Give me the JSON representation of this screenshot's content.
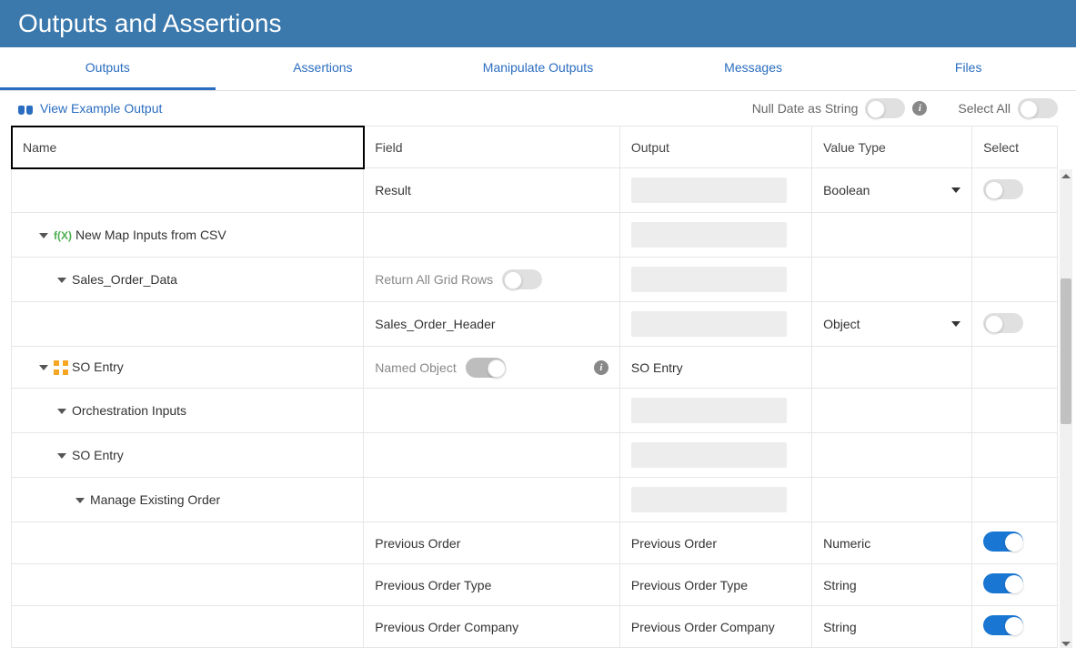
{
  "header": {
    "title": "Outputs and Assertions"
  },
  "tabs": [
    {
      "label": "Outputs",
      "active": true
    },
    {
      "label": "Assertions",
      "active": false
    },
    {
      "label": "Manipulate Outputs",
      "active": false
    },
    {
      "label": "Messages",
      "active": false
    },
    {
      "label": "Files",
      "active": false
    }
  ],
  "toolbar": {
    "view_example": "View Example Output",
    "null_date_label": "Null Date as String",
    "null_date_on": false,
    "select_all_label": "Select All",
    "select_all_on": false
  },
  "columns": {
    "name": "Name",
    "field": "Field",
    "output": "Output",
    "value_type": "Value Type",
    "select": "Select"
  },
  "rows": [
    {
      "name": "",
      "indent": 0,
      "icon": null,
      "caret": false,
      "field": {
        "kind": "text",
        "text": "Result"
      },
      "output": {
        "kind": "box"
      },
      "value_type": {
        "text": "Boolean",
        "dropdown": true
      },
      "select": {
        "kind": "toggle",
        "on": false
      }
    },
    {
      "name": "New Map Inputs from CSV",
      "indent": 1,
      "icon": "fx",
      "caret": true,
      "field": {
        "kind": "empty"
      },
      "output": {
        "kind": "box"
      },
      "value_type": {
        "text": "",
        "dropdown": false
      },
      "select": {
        "kind": "none"
      }
    },
    {
      "name": "Sales_Order_Data",
      "indent": 2,
      "icon": null,
      "caret": true,
      "field": {
        "kind": "toggle",
        "label": "Return All Grid Rows",
        "on": false
      },
      "output": {
        "kind": "box"
      },
      "value_type": {
        "text": "",
        "dropdown": false
      },
      "select": {
        "kind": "none"
      }
    },
    {
      "name": "",
      "indent": 0,
      "icon": null,
      "caret": false,
      "field": {
        "kind": "text",
        "text": "Sales_Order_Header"
      },
      "output": {
        "kind": "box"
      },
      "value_type": {
        "text": "Object",
        "dropdown": true
      },
      "select": {
        "kind": "toggle",
        "on": false
      }
    },
    {
      "name": "SO Entry",
      "indent": 1,
      "icon": "so",
      "caret": true,
      "field": {
        "kind": "toggle_info",
        "label": "Named Object",
        "on": true
      },
      "output": {
        "kind": "text",
        "text": "SO Entry"
      },
      "value_type": {
        "text": "",
        "dropdown": false
      },
      "select": {
        "kind": "none"
      }
    },
    {
      "name": "Orchestration Inputs",
      "indent": 2,
      "icon": null,
      "caret": true,
      "field": {
        "kind": "empty"
      },
      "output": {
        "kind": "box"
      },
      "value_type": {
        "text": "",
        "dropdown": false
      },
      "select": {
        "kind": "none"
      }
    },
    {
      "name": "SO Entry",
      "indent": 2,
      "icon": null,
      "caret": true,
      "field": {
        "kind": "empty"
      },
      "output": {
        "kind": "box"
      },
      "value_type": {
        "text": "",
        "dropdown": false
      },
      "select": {
        "kind": "none"
      }
    },
    {
      "name": "Manage Existing Order",
      "indent": 3,
      "icon": null,
      "caret": true,
      "field": {
        "kind": "empty"
      },
      "output": {
        "kind": "box"
      },
      "value_type": {
        "text": "",
        "dropdown": false
      },
      "select": {
        "kind": "none"
      }
    },
    {
      "name": "",
      "indent": 0,
      "icon": null,
      "caret": false,
      "field": {
        "kind": "text",
        "text": "Previous Order"
      },
      "output": {
        "kind": "text",
        "text": "Previous Order"
      },
      "value_type": {
        "text": "Numeric",
        "dropdown": false
      },
      "select": {
        "kind": "toggle",
        "on": true
      }
    },
    {
      "name": "",
      "indent": 0,
      "icon": null,
      "caret": false,
      "field": {
        "kind": "text",
        "text": "Previous Order Type"
      },
      "output": {
        "kind": "text",
        "text": "Previous Order Type"
      },
      "value_type": {
        "text": "String",
        "dropdown": false
      },
      "select": {
        "kind": "toggle",
        "on": true
      }
    },
    {
      "name": "",
      "indent": 0,
      "icon": null,
      "caret": false,
      "field": {
        "kind": "text",
        "text": "Previous Order Company"
      },
      "output": {
        "kind": "text",
        "text": "Previous Order Company"
      },
      "value_type": {
        "text": "String",
        "dropdown": false
      },
      "select": {
        "kind": "toggle",
        "on": true
      }
    }
  ]
}
